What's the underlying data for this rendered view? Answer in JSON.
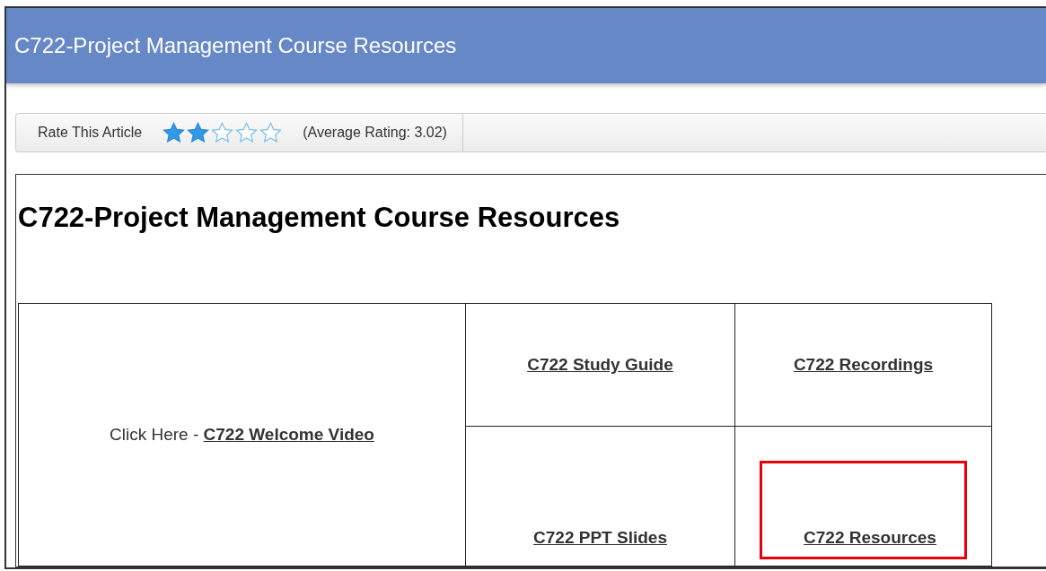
{
  "header": {
    "title": "C722-Project Management Course Resources"
  },
  "rating": {
    "label": "Rate This Article",
    "stars": 2,
    "average": "(Average Rating: 3.02)"
  },
  "article": {
    "heading": "C722-Project Management Course Resources",
    "video": {
      "prompt": "Click Here -",
      "link": "C722 Welcome Video"
    },
    "links": [
      {
        "label": "C722 Study Guide",
        "highlighted": false
      },
      {
        "label": "C722 Recordings",
        "highlighted": false
      },
      {
        "label": "C722 PPT Slides",
        "highlighted": false
      },
      {
        "label": "C722 Resources",
        "highlighted": true
      }
    ]
  }
}
